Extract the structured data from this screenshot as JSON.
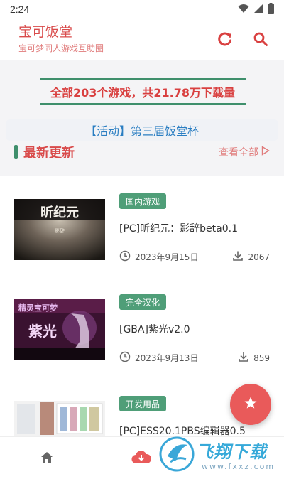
{
  "status_bar": {
    "time": "2:24",
    "icons": [
      "wifi-icon",
      "signal-icon",
      "battery-icon"
    ]
  },
  "header": {
    "title": "宝可饭堂",
    "subtitle": "宝可梦同人游戏互助圈",
    "actions": [
      "refresh-icon",
      "search-icon"
    ]
  },
  "banner": {
    "text": "全部203个游戏，共21.78万下载量"
  },
  "activity": {
    "text": "【活动】第三届饭堂杯"
  },
  "section": {
    "title": "最新更新",
    "see_all": "查看全部"
  },
  "games": [
    {
      "tag": "国内游戏",
      "title": "[PC]昕纪元：影辞beta0.1",
      "date": "2023年9月15日",
      "downloads": "2067",
      "thumb_text": "昕纪元",
      "thumb_sub": "影辞"
    },
    {
      "tag": "完全汉化",
      "title": "[GBA]紫光v2.0",
      "date": "2023年9月13日",
      "downloads": "859",
      "thumb_text": "紫光",
      "thumb_sub": "精灵宝可梦"
    },
    {
      "tag": "开发用品",
      "title": "[PC]ESS20.1PBS编辑器0.5",
      "date": "",
      "downloads": "",
      "thumb_text": "",
      "thumb_sub": ""
    }
  ],
  "watermark": {
    "title": "飞翔下载",
    "url": "www.fxxz.com"
  },
  "colors": {
    "accent_red": "#d94b4b",
    "accent_green": "#3f8f6c",
    "link_blue": "#2a7ec2",
    "fab": "#e95a5a"
  }
}
